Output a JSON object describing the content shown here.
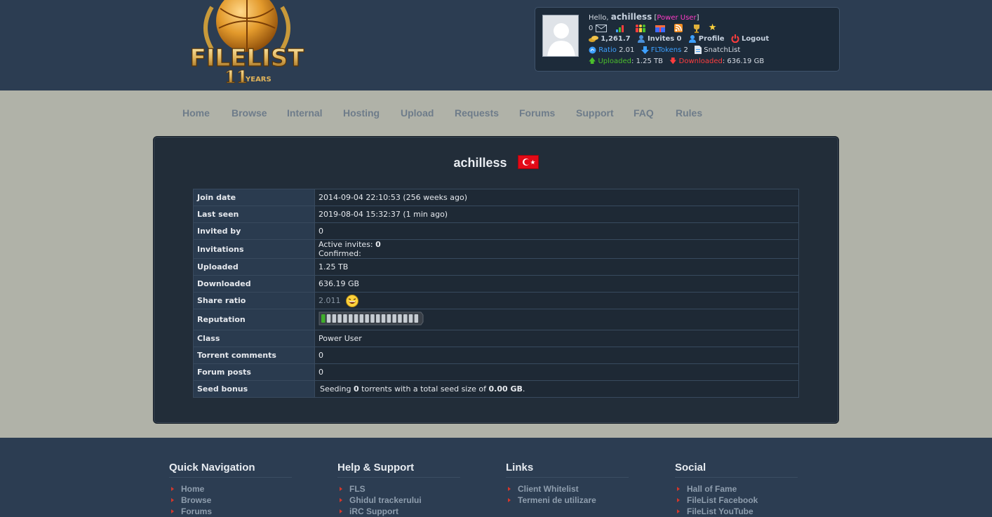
{
  "logo": {
    "text": "FILELIST",
    "years_num": "11",
    "years_word": "YEARS"
  },
  "userbox": {
    "hello": "Hello, ",
    "username": "achilless",
    "bracket_open": "[",
    "user_class": "Power User",
    "bracket_close": "]",
    "messages_count": "0",
    "bonus": "1,261.7",
    "invites_label": "Invites",
    "invites_count": "0",
    "profile_label": "Profile",
    "logout_label": "Logout",
    "ratio_label": "Ratio",
    "ratio_value": "2.01",
    "fltokens_label": "FLTokens",
    "fltokens_value": "2",
    "snatchlist_label": "SnatchList",
    "uploaded_label": "Uploaded",
    "uploaded_value": ": 1.25 TB",
    "downloaded_label": "Downloaded",
    "downloaded_value": ": 636.19 GB"
  },
  "nav": [
    "Home",
    "Browse",
    "Internal",
    "Hosting",
    "Upload",
    "Requests",
    "Forums",
    "Support",
    "FAQ",
    "Rules"
  ],
  "profile": {
    "username": "achilless",
    "rows": {
      "join_date": {
        "label": "Join date",
        "value": "2014-09-04 22:10:53 (256 weeks ago)"
      },
      "last_seen": {
        "label": "Last seen",
        "value": "2019-08-04 15:32:37 (1 min ago)"
      },
      "invited_by": {
        "label": "Invited by",
        "value": "0"
      },
      "invitations": {
        "label": "Invitations",
        "active_prefix": "Active invites: ",
        "active_value": "0",
        "confirmed": "Confirmed:"
      },
      "uploaded": {
        "label": "Uploaded",
        "value": "1.25 TB"
      },
      "downloaded": {
        "label": "Downloaded",
        "value": "636.19 GB"
      },
      "share_ratio": {
        "label": "Share ratio",
        "value": "2.011"
      },
      "reputation": {
        "label": "Reputation",
        "level": 0.08
      },
      "class": {
        "label": "Class",
        "value": "Power User"
      },
      "torrent_comments": {
        "label": "Torrent comments",
        "value": "0"
      },
      "forum_posts": {
        "label": "Forum posts",
        "value": "0"
      },
      "seed_bonus": {
        "label": "Seed bonus",
        "prefix": "Seeding ",
        "count": "0",
        "middle": " torrents with a total seed size of ",
        "size": "0.00 GB",
        "suffix": "."
      }
    }
  },
  "footer": {
    "quick_nav": {
      "title": "Quick Navigation",
      "items": [
        "Home",
        "Browse",
        "Forums"
      ]
    },
    "help": {
      "title": "Help & Support",
      "items": [
        "FLS",
        "Ghidul trackerului",
        "iRC Support"
      ]
    },
    "links": {
      "title": "Links",
      "items": [
        "Client Whitelist",
        "Termeni de utilizare"
      ]
    },
    "social": {
      "title": "Social",
      "items": [
        "Hall of Fame",
        "FileList Facebook",
        "FileList YouTube"
      ]
    }
  },
  "colors": {
    "header_bg": "#2c3d52",
    "page_bg": "#b0b2a8",
    "panel_bg": "#222d39",
    "class_pink": "#ff3cc7",
    "link_blue": "#3da0ff",
    "upload_green": "#4bbf2b",
    "download_red": "#ff3d3d"
  }
}
